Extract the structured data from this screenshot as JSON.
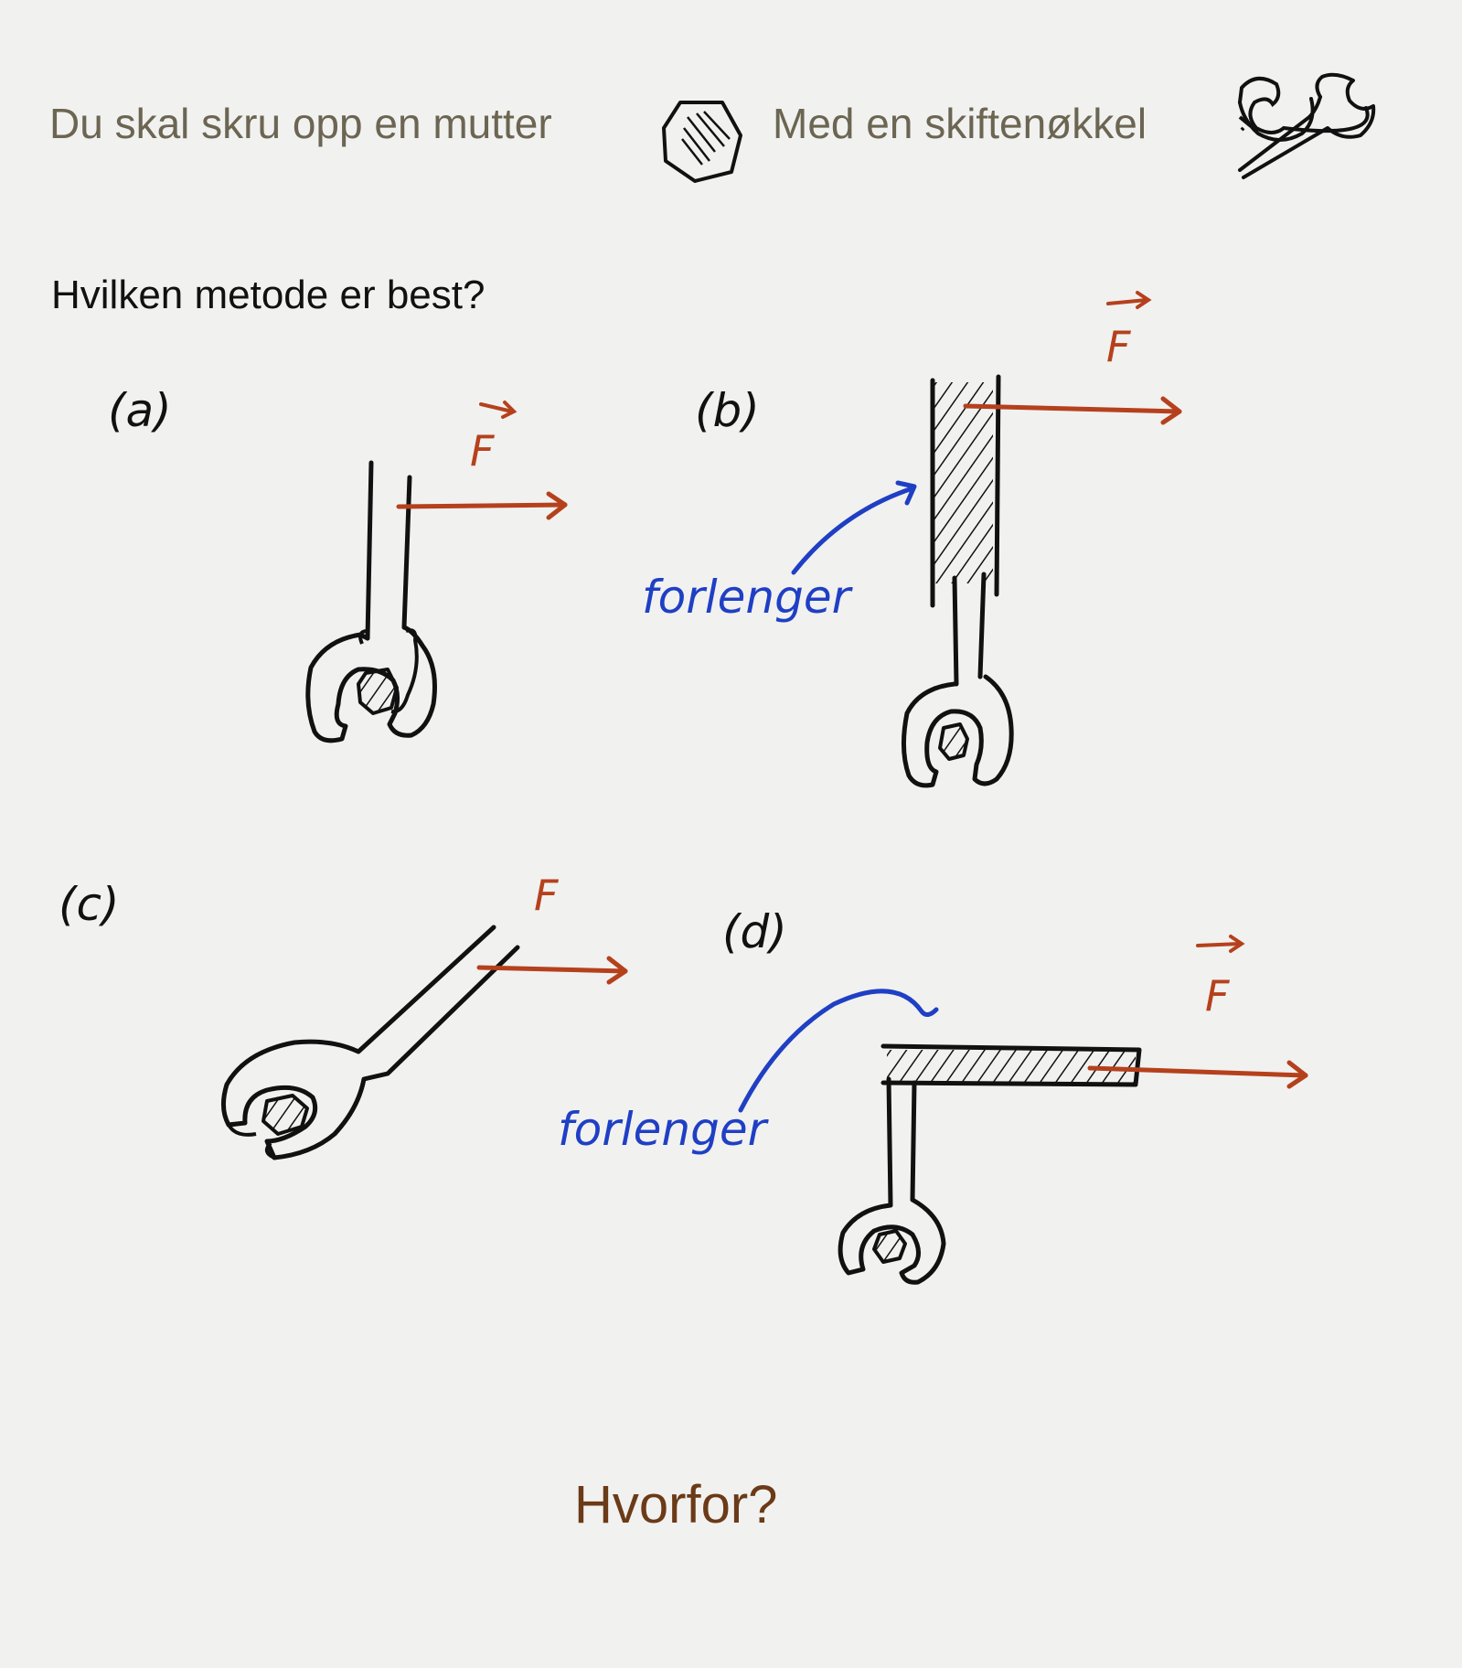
{
  "intro": {
    "nut_text": "Du skal skru opp en mutter",
    "wrench_text": "Med en skiftenøkkel",
    "nut_icon": "nut-icon",
    "wrench_icon": "wrench-icon"
  },
  "question": "Hvilken metode er best?",
  "methods": [
    {
      "label": "(a)",
      "force": "F"
    },
    {
      "label": "(b)",
      "force": "F",
      "extension": "forlenger"
    },
    {
      "label": "(c)",
      "force": "F"
    },
    {
      "label": "(d)",
      "force": "F",
      "extension": "forlenger"
    }
  ],
  "followup": "Hvorfor?",
  "colors": {
    "ink": "#111111",
    "force": "#b5411c",
    "extension": "#1f3fc4",
    "intro_text": "#6b6552",
    "followup_text": "#6b3a17"
  }
}
